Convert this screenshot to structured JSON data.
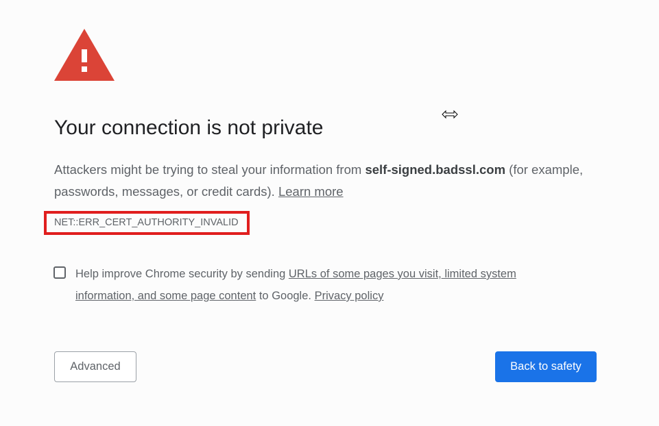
{
  "page": {
    "title": "Your connection is not private",
    "description_pre": "Attackers might be trying to steal your information from ",
    "host": "self-signed.badssl.com",
    "description_post": " (for example, passwords, messages, or credit cards). ",
    "learn_more": "Learn more",
    "error_code": "NET::ERR_CERT_AUTHORITY_INVALID"
  },
  "opt_in": {
    "checked": false,
    "text_pre": "Help improve Chrome security by sending ",
    "link_urls": "URLs of some pages you visit, limited system information, and some page content",
    "text_mid": " to Google. ",
    "link_privacy": "Privacy policy"
  },
  "buttons": {
    "advanced": "Advanced",
    "back_to_safety": "Back to safety"
  },
  "colors": {
    "warning": "#db4437",
    "primary_button": "#1a73e8",
    "highlight_box": "#e01e1e",
    "background": "#fcfcfc"
  },
  "icons": {
    "warning": "warning-triangle-icon",
    "cursor": "resize-horizontal-cursor-icon"
  }
}
